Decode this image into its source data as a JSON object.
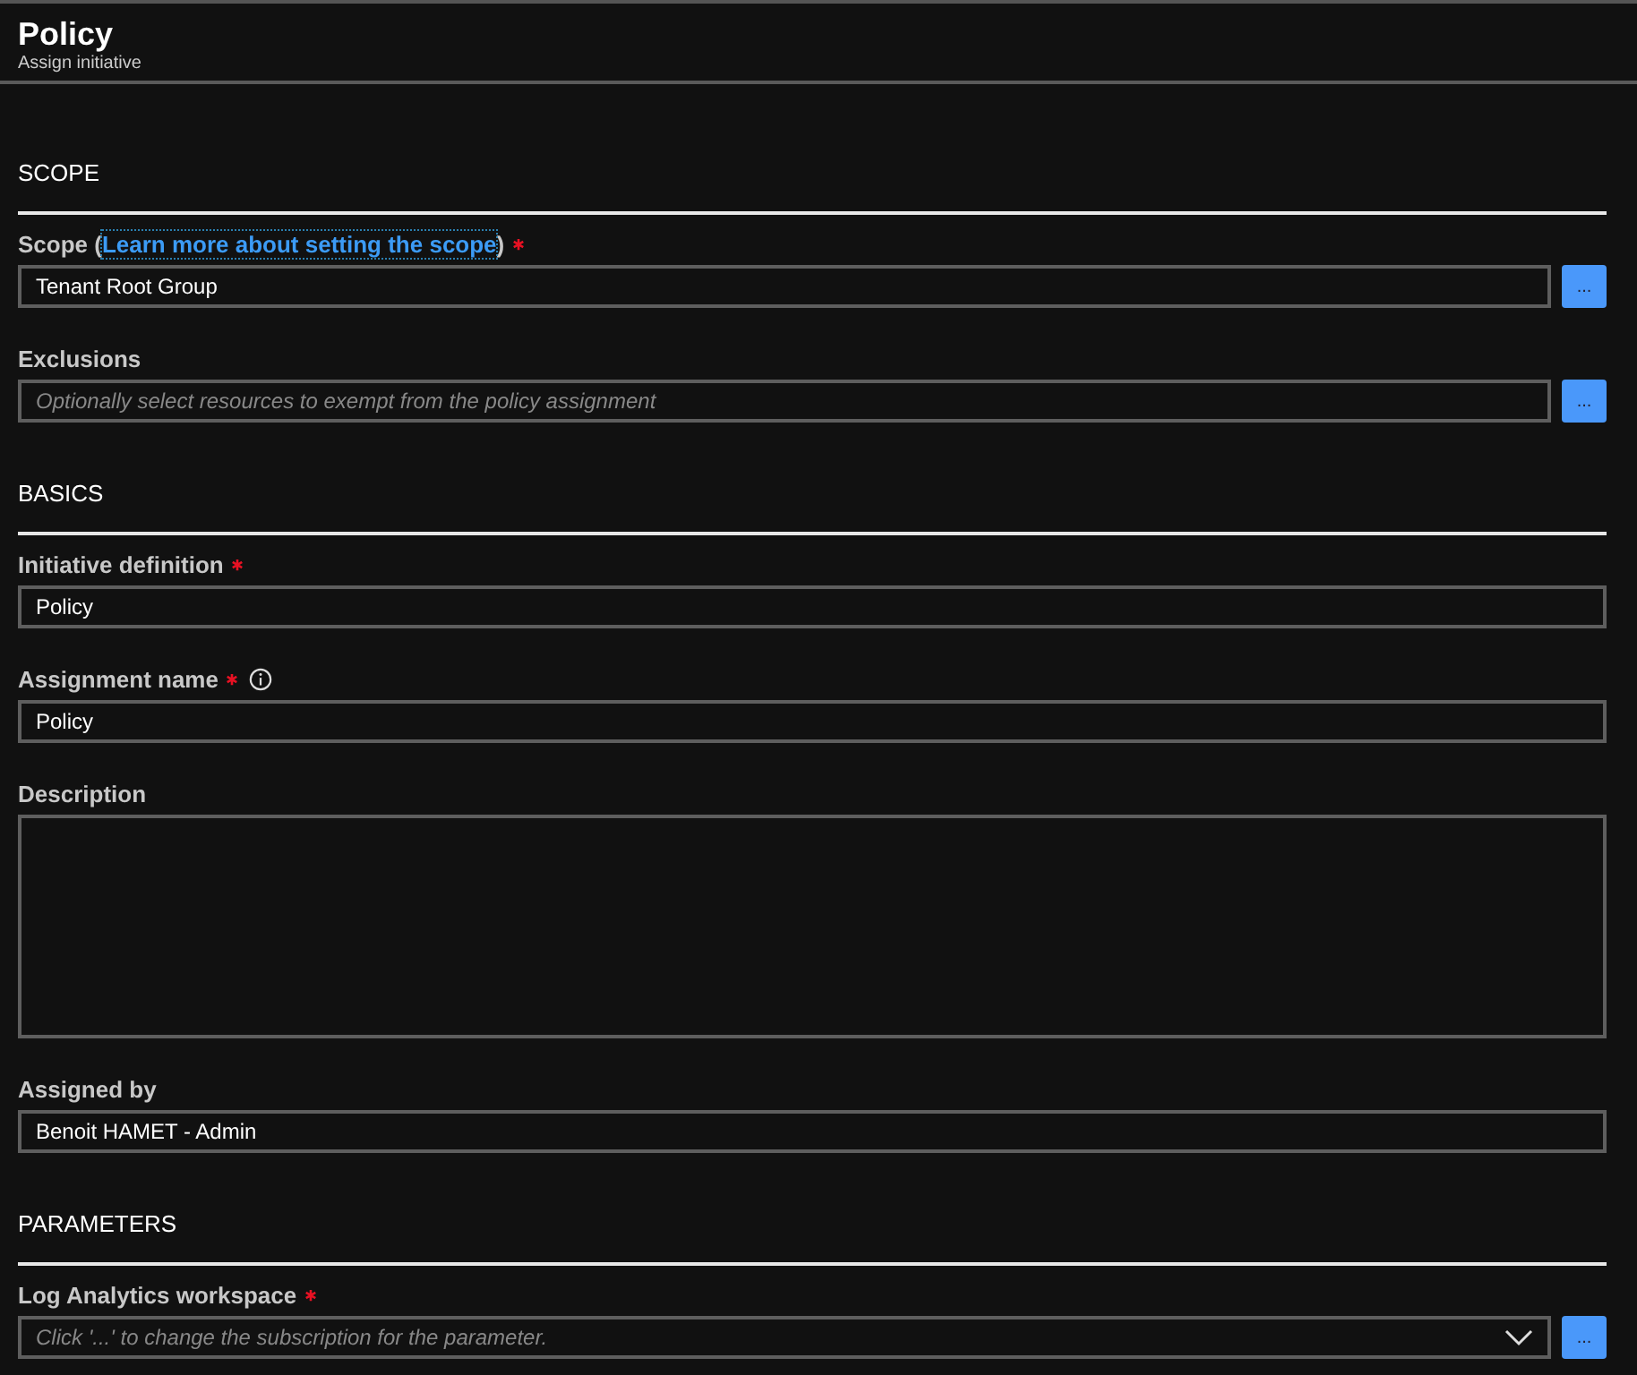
{
  "header": {
    "title": "Policy",
    "subtitle": "Assign initiative"
  },
  "sections": [
    {
      "heading": "SCOPE",
      "fields": [
        {
          "kind": "input",
          "label": "Scope (",
          "link": "Learn more about setting the scope",
          "label_after": ")",
          "required": true,
          "info": false,
          "value": "Tenant Root Group",
          "button": "..."
        },
        {
          "kind": "input",
          "label": "Exclusions",
          "required": false,
          "info": false,
          "placeholder": "Optionally select resources to exempt from the policy assignment",
          "button": "..."
        }
      ]
    },
    {
      "heading": "BASICS",
      "fields": [
        {
          "kind": "input",
          "label": "Initiative definition",
          "required": true,
          "info": false,
          "value": "Policy"
        },
        {
          "kind": "input",
          "label": "Assignment name",
          "required": true,
          "info": true,
          "value": "Policy"
        },
        {
          "kind": "textarea",
          "label": "Description",
          "required": false,
          "info": false
        },
        {
          "kind": "input",
          "label": "Assigned by",
          "required": false,
          "info": false,
          "value": "Benoit HAMET - Admin"
        }
      ]
    },
    {
      "heading": "PARAMETERS",
      "fields": [
        {
          "kind": "dropdown",
          "label": "Log Analytics workspace",
          "required": true,
          "info": false,
          "placeholder": "Click '...' to change the subscription for the parameter.",
          "button": "..."
        }
      ]
    }
  ]
}
